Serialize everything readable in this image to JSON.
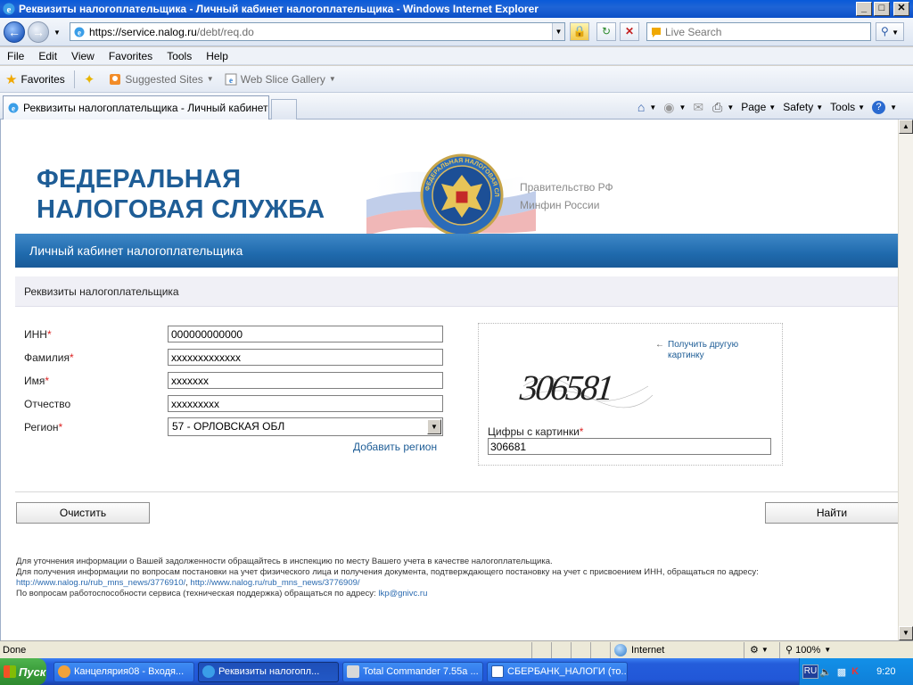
{
  "window": {
    "title": "Реквизиты налогоплательщика - Личный кабинет налогоплательщика - Windows Internet Explorer",
    "btn_minimize": "_",
    "btn_maximize": "□",
    "btn_close": "✕"
  },
  "address": {
    "url_prefix": "https://service.",
    "url_host": "nalog.ru",
    "url_path": "/debt/req.do",
    "search_placeholder": "Live Search"
  },
  "menu": [
    "File",
    "Edit",
    "View",
    "Favorites",
    "Tools",
    "Help"
  ],
  "favorites_bar": {
    "favorites_label": "Favorites",
    "suggested_sites": "Suggested Sites",
    "web_slice_gallery": "Web Slice Gallery"
  },
  "tab": {
    "active_title": "Реквизиты налогоплательщика - Личный кабинет ..."
  },
  "command_bar": {
    "page": "Page",
    "safety": "Safety",
    "tools": "Tools"
  },
  "header": {
    "fns_line1": "ФЕДЕРАЛЬНАЯ",
    "fns_line2": "НАЛОГОВАЯ СЛУЖБА",
    "gov_link1": "Правительство РФ",
    "gov_link2": "Минфин России",
    "emblem_text": "ФЕДЕРАЛЬНАЯ НАЛОГОВАЯ СЛУЖБА",
    "banner": "Личный кабинет налогоплательщика"
  },
  "section_title": "Реквизиты налогоплательщика",
  "form": {
    "inn_label": "ИНН",
    "inn_value": "000000000000",
    "surname_label": "Фамилия",
    "surname_value": "xxxxxxxxxxxxx",
    "name_label": "Имя",
    "name_value": "xxxxxxx",
    "patronymic_label": "Отчество",
    "patronymic_value": "xxxxxxxxx",
    "region_label": "Регион",
    "region_value": "57 - ОРЛОВСКАЯ ОБЛ",
    "required_mark": "*",
    "add_region": "Добавить регион"
  },
  "captcha": {
    "other_picture": "Получить другую картинку",
    "image_digits": "306581",
    "label": "Цифры с картинки",
    "value": "306681"
  },
  "buttons": {
    "clear": "Очистить",
    "find": "Найти"
  },
  "info": {
    "line1": "Для уточнения информации о Вашей задолженности обращайтесь в инспекцию по месту Вашего учета в качестве налогоплательщика.",
    "line2": "Для получения информации по вопросам постановки на учет физического лица и получения документа, подтверждающего постановку на учет с присвоением ИНН, обращаться по адресу:",
    "link1": "http://www.nalog.ru/rub_mns_news/3776910/",
    "link_sep": ", ",
    "link2": "http://www.nalog.ru/rub_mns_news/3776909/",
    "line4": "По вопросам работоспособности сервиса (техническая поддержка) обращаться по адресу:",
    "email": "lkp@gnivc.ru"
  },
  "status": {
    "text": "Done",
    "zone": "Internet",
    "zoom": "100%"
  },
  "taskbar": {
    "start": "Пуск",
    "tasks": [
      "Канцелярия08 - Входя...",
      "Реквизиты налогопл...",
      "Total Commander 7.55a ...",
      "СБЕРБАНК_НАЛОГИ (то..."
    ],
    "lang": "RU",
    "clock": "9:20"
  },
  "colors": {
    "brand_blue": "#1e5d96",
    "banner_blue": "#1f6aad",
    "required_red": "#dd2222"
  }
}
